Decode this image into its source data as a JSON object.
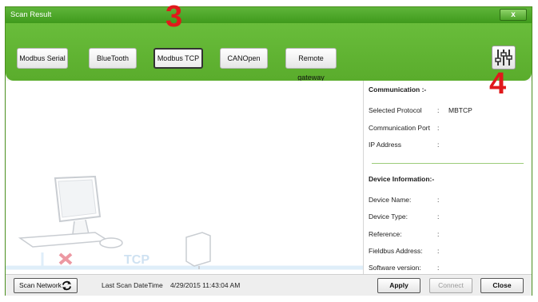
{
  "window": {
    "title": "Scan Result",
    "close_label": "x"
  },
  "toolbar": {
    "tabs": [
      {
        "label": "Modbus Serial"
      },
      {
        "label": "BlueTooth"
      },
      {
        "label": "Modbus TCP",
        "active": true
      },
      {
        "label": "CANOpen"
      },
      {
        "label": "Remote gateway"
      }
    ],
    "settings_icon": "sliders-icon"
  },
  "annotations": {
    "tab_marker": "3",
    "settings_marker": "4"
  },
  "illustration": {
    "label": "TCP"
  },
  "communication": {
    "title": "Communication :-",
    "rows": [
      {
        "label": "Selected Protocol",
        "colon": ":",
        "value": "MBTCP"
      },
      {
        "label": "Communication Port",
        "colon": ":",
        "value": ""
      },
      {
        "label": "IP Address",
        "colon": ":",
        "value": ""
      }
    ]
  },
  "device_info": {
    "title": "Device Information:-",
    "rows": [
      {
        "label": "Device Name:",
        "colon": ":",
        "value": ""
      },
      {
        "label": "Device Type:",
        "colon": ":",
        "value": ""
      },
      {
        "label": "Reference:",
        "colon": ":",
        "value": ""
      },
      {
        "label": "Fieldbus Address:",
        "colon": ":",
        "value": ""
      },
      {
        "label": "Software version:",
        "colon": ":",
        "value": ""
      }
    ]
  },
  "bottom": {
    "scan_network_label": "Scan Network",
    "last_scan_label": "Last Scan DateTime",
    "last_scan_value": "4/29/2015 11:43:04 AM",
    "apply_label": "Apply",
    "connect_label": "Connect",
    "close_label": "Close"
  },
  "colors": {
    "brand_green": "#5aac2c",
    "annotation_red": "#e0191b"
  }
}
